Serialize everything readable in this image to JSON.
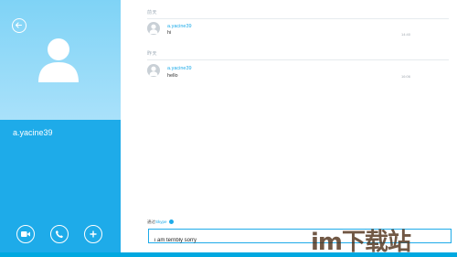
{
  "contact": {
    "name": "a.yacine39"
  },
  "messages": [
    {
      "day": "前天",
      "sender": "a.yacine39",
      "text": "hi",
      "time": "14:40"
    },
    {
      "day": "昨天",
      "sender": "a.yacine39",
      "text": "hello",
      "time": "16:06"
    }
  ],
  "composer": {
    "via_prefix": "通过",
    "via_service": "Skype",
    "value": "i am terribly sorry"
  },
  "watermark": "im下载站",
  "colors": {
    "accent": "#1eabe9",
    "panel_top": "#a9e1fa"
  },
  "icons": [
    "back-arrow-icon",
    "contact-avatar-icon",
    "video-call-icon",
    "phone-call-icon",
    "add-icon"
  ]
}
